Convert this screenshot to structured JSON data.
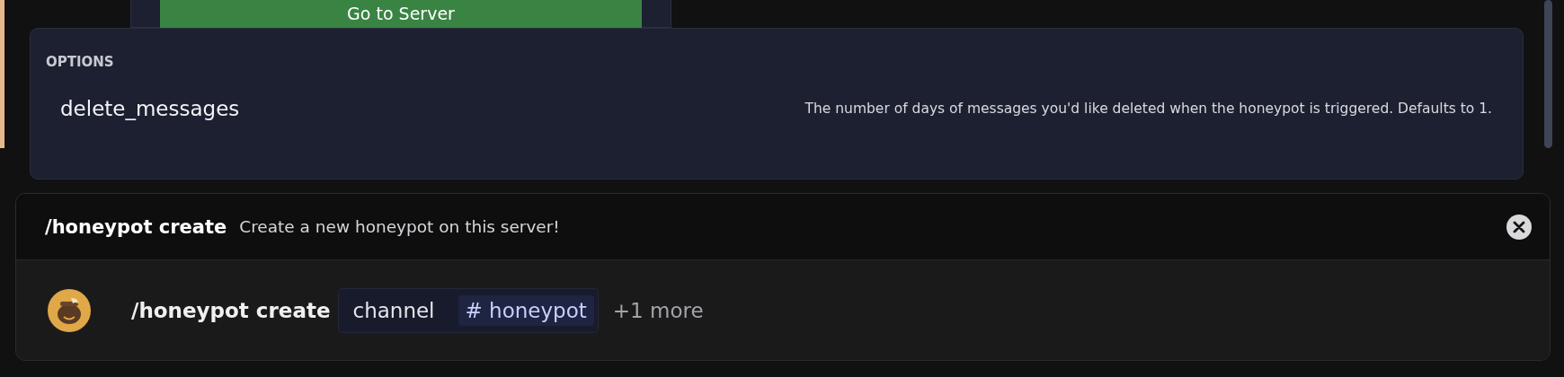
{
  "background_dialog": {
    "button": "Go to Server"
  },
  "options": {
    "heading": "OPTIONS",
    "items": [
      {
        "name": "delete_messages",
        "description": "The number of days of messages you'd like deleted when the honeypot is triggered. Defaults to 1."
      }
    ]
  },
  "command": {
    "name": "/honeypot create",
    "description": "Create a new honeypot on this server!"
  },
  "input": {
    "command": "/honeypot create",
    "options": [
      {
        "name": "channel",
        "value": "# honeypot"
      }
    ],
    "more": "+1 more"
  }
}
